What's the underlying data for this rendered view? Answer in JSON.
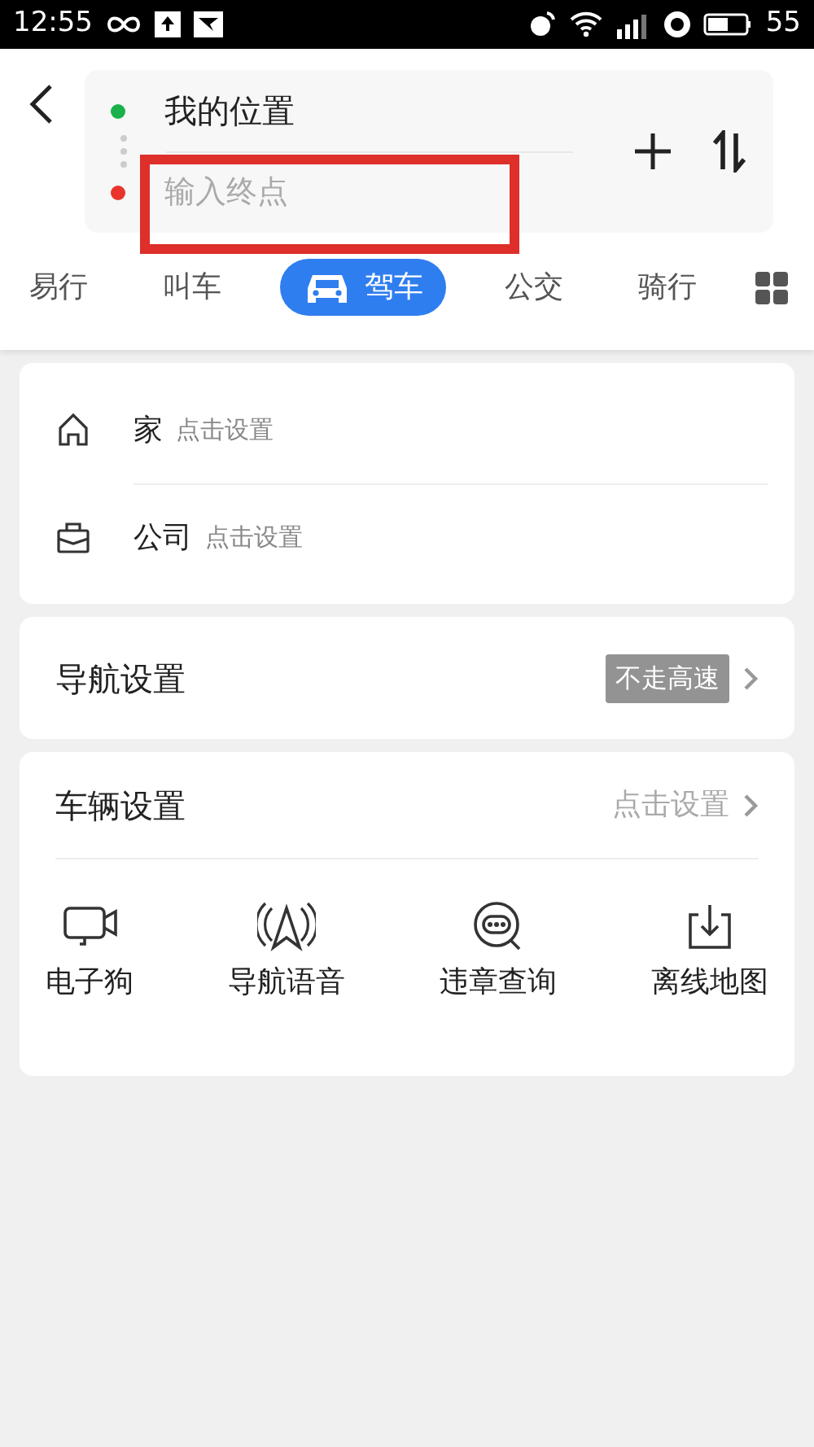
{
  "status_bar": {
    "time": "12:55",
    "battery": "55"
  },
  "route": {
    "origin": "我的位置",
    "destination": {
      "placeholder": "输入终点",
      "highlighted": true
    }
  },
  "tabs": [
    {
      "label": "易行",
      "selected": false
    },
    {
      "label": "叫车",
      "selected": false
    },
    {
      "label": "驾车",
      "selected": true
    },
    {
      "label": "公交",
      "selected": false
    },
    {
      "label": "骑行",
      "selected": false
    }
  ],
  "places": [
    {
      "kind": "home",
      "label": "家",
      "hint": "点击设置"
    },
    {
      "kind": "work",
      "label": "公司",
      "hint": "点击设置"
    }
  ],
  "navigation_settings": {
    "title": "导航设置",
    "tag": "不走高速"
  },
  "vehicle_settings": {
    "title": "车辆设置",
    "hint": "点击设置",
    "tools": [
      {
        "kind": "camera",
        "label": "电子狗"
      },
      {
        "kind": "voice",
        "label": "导航语音"
      },
      {
        "kind": "violation",
        "label": "违章查询"
      },
      {
        "kind": "offline",
        "label": "离线地图"
      }
    ]
  }
}
